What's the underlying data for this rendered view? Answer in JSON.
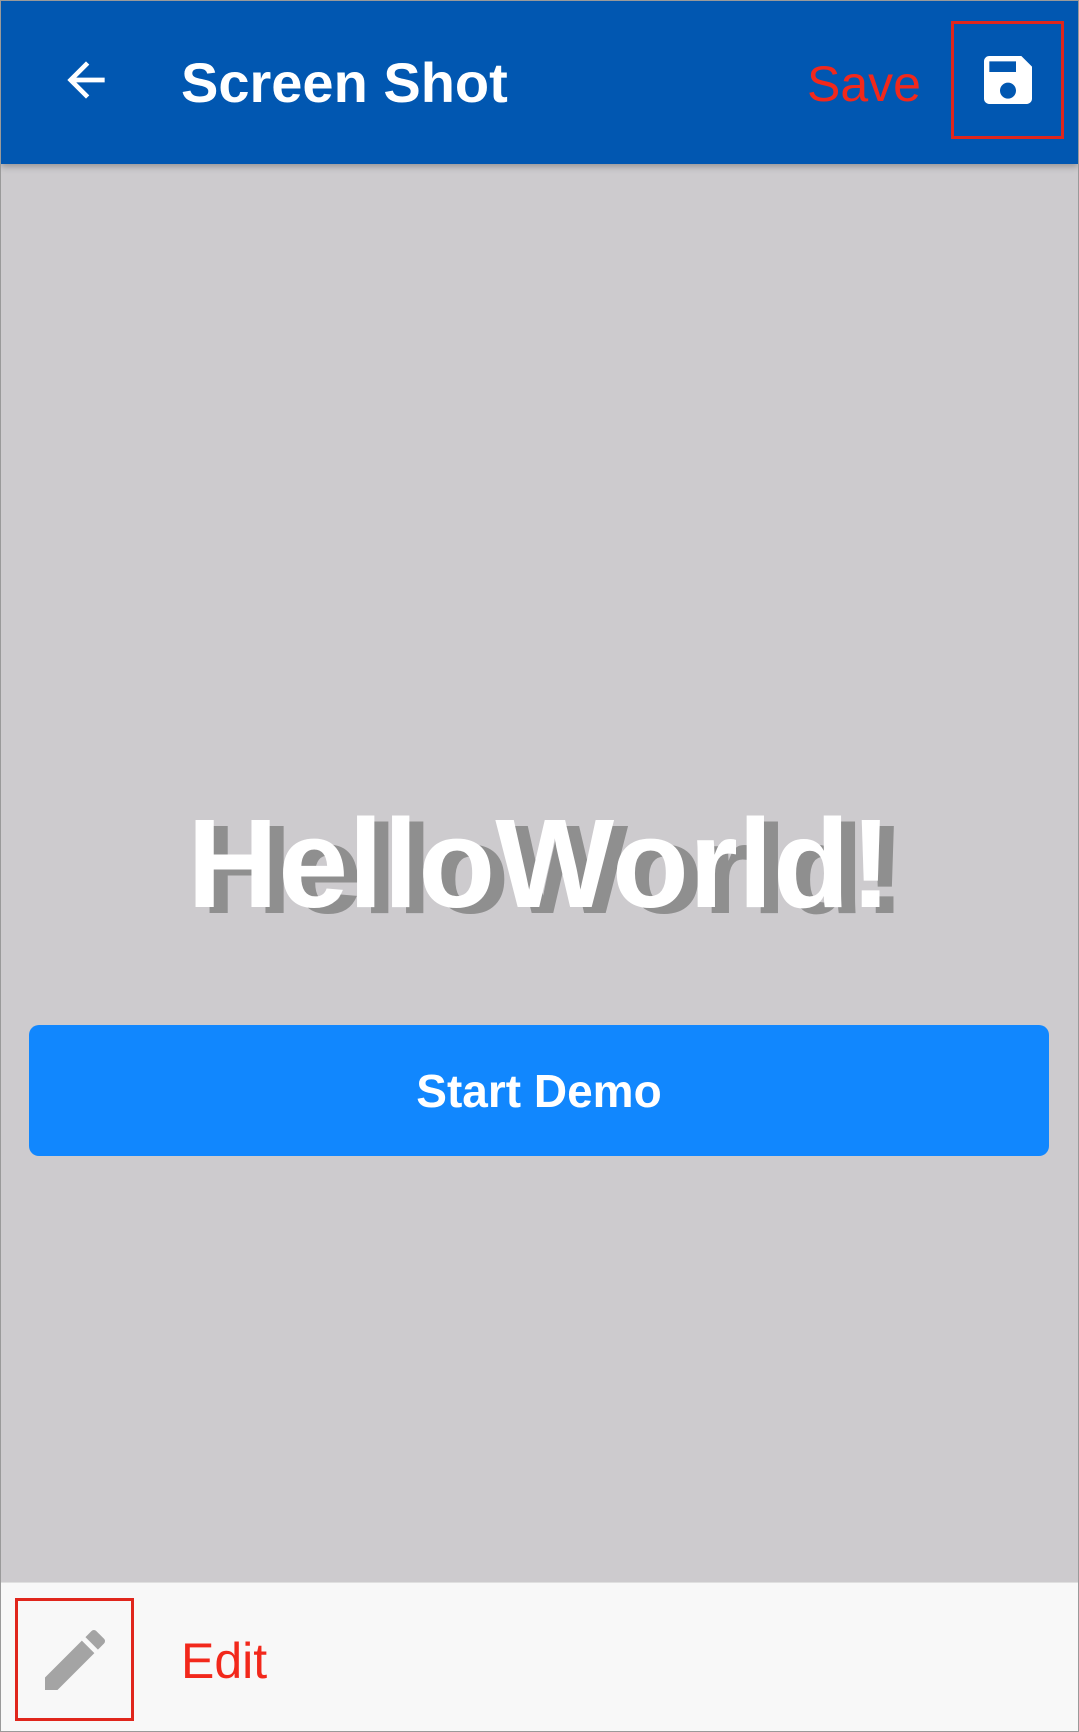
{
  "app_bar": {
    "title": "Screen Shot",
    "back_icon": "arrow-left-icon",
    "save_icon": "floppy-disk-icon",
    "background_color": "#0157b1"
  },
  "annotations": {
    "save_label": "Save",
    "edit_label": "Edit",
    "annotation_color": "#f2281b"
  },
  "main": {
    "headline": "HelloWorld!",
    "start_button_label": "Start Demo",
    "start_button_color": "#1187fe",
    "background_color": "#cdcbce"
  },
  "bottom_bar": {
    "edit_icon": "pencil-icon"
  }
}
